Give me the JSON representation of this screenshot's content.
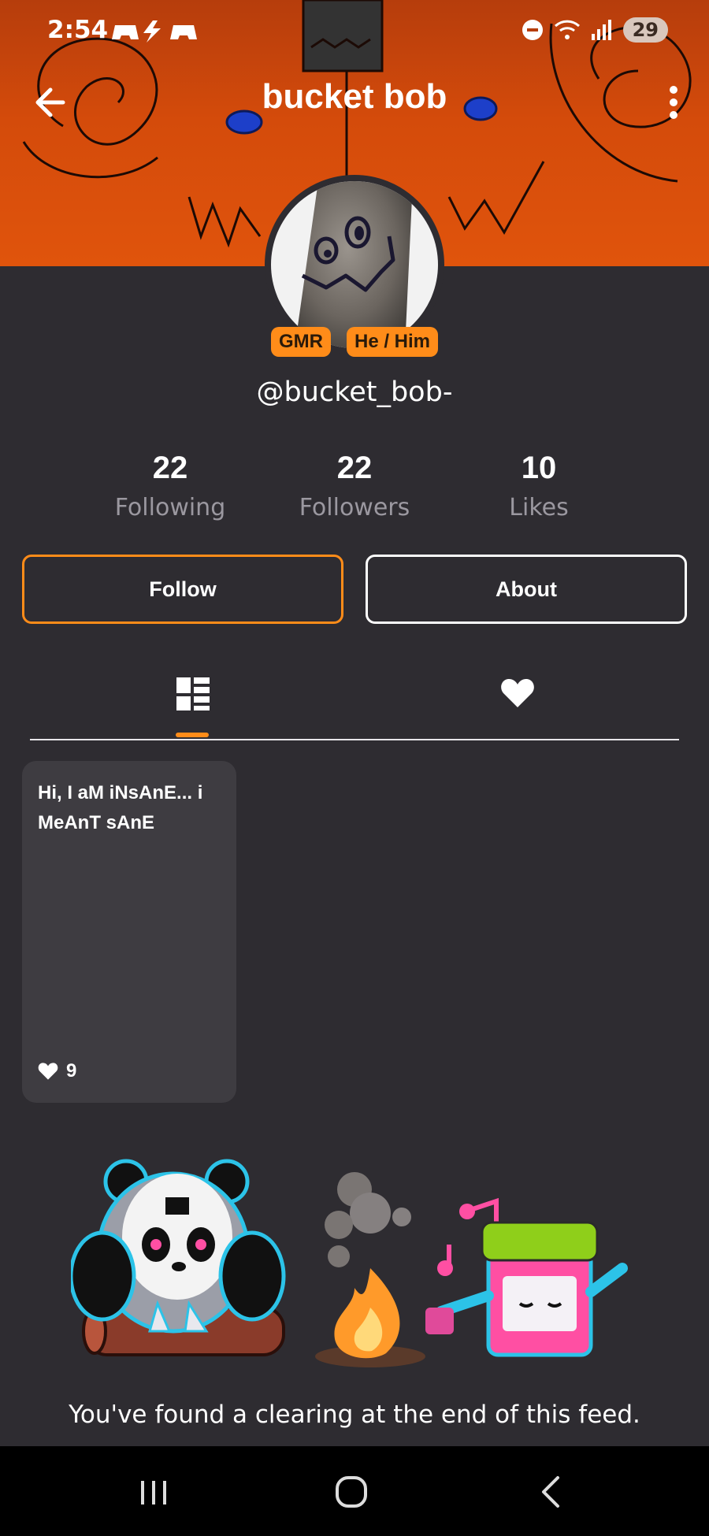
{
  "status_bar": {
    "time": "2:54",
    "battery": "29"
  },
  "header": {
    "title": "bucket bob"
  },
  "profile": {
    "handle": "@bucket_bob-",
    "badges": [
      "GMR",
      "He / Him"
    ]
  },
  "stats": [
    {
      "value": "22",
      "label": "Following"
    },
    {
      "value": "22",
      "label": "Followers"
    },
    {
      "value": "10",
      "label": "Likes"
    }
  ],
  "actions": {
    "follow_label": "Follow",
    "about_label": "About"
  },
  "tabs": {
    "icons": [
      "grid-icon",
      "heart-icon"
    ],
    "active": 0
  },
  "posts": [
    {
      "text": "Hi, I aM iNsAnE... i MeAnT sAnE",
      "likes": "9"
    }
  ],
  "feed_end": {
    "message": "You've found a clearing at the end of this feed."
  },
  "colors": {
    "accent": "#ff8c19",
    "background": "#2e2c31",
    "card": "#3e3c41",
    "banner": "#d44b0b"
  }
}
